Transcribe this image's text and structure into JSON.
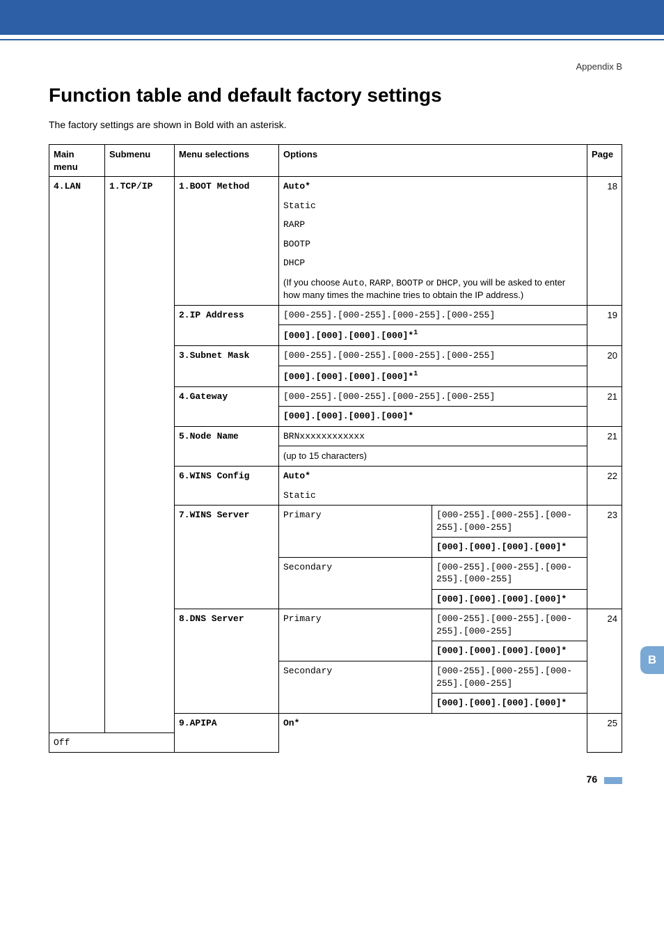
{
  "appendix_label": "Appendix B",
  "heading": "Function table and default factory settings",
  "intro": "The factory settings are shown in Bold with an asterisk.",
  "table": {
    "headers": {
      "main_menu": "Main menu",
      "submenu": "Submenu",
      "menu_selections": "Menu selections",
      "options": "Options",
      "page": "Page"
    },
    "main_menu": "4.LAN",
    "submenu": "1.TCP/IP",
    "rows": {
      "boot_method": {
        "label": "1.BOOT Method",
        "page": "18",
        "opt_auto": "Auto*",
        "opt_static": "Static",
        "opt_rarp": "RARP",
        "opt_bootp": "BOOTP",
        "opt_dhcp": "DHCP",
        "note_pre": "(If you choose ",
        "note_code1": "Auto",
        "note_sep1": ", ",
        "note_code2": "RARP",
        "note_sep2": ", ",
        "note_code3": "BOOTP",
        "note_sep3": " or ",
        "note_code4": "DHCP",
        "note_post": ", you will be asked to enter how many times the machine tries to obtain the IP address.)"
      },
      "ip_address": {
        "label": "2.IP Address",
        "page": "19",
        "range": "[000-255].[000-255].[000-255].[000-255]",
        "default": "[000].[000].[000].[000]*",
        "foot": "1"
      },
      "subnet_mask": {
        "label": "3.Subnet Mask",
        "page": "20",
        "range": "[000-255].[000-255].[000-255].[000-255]",
        "default": "[000].[000].[000].[000]*",
        "foot": "1"
      },
      "gateway": {
        "label": "4.Gateway",
        "page": "21",
        "range": "[000-255].[000-255].[000-255].[000-255]",
        "default": "[000].[000].[000].[000]*"
      },
      "node_name": {
        "label": "5.Node Name",
        "page": "21",
        "value": "BRNxxxxxxxxxxxx",
        "note": "(up to 15 characters)"
      },
      "wins_config": {
        "label": "6.WINS Config",
        "page": "22",
        "opt_auto": "Auto*",
        "opt_static": "Static"
      },
      "wins_server": {
        "label": "7.WINS Server",
        "page": "23",
        "primary_label": "Primary",
        "secondary_label": "Secondary",
        "range": "[000-255].[000-255].[000-255].[000-255]",
        "default": "[000].[000].[000].[000]*"
      },
      "dns_server": {
        "label": "8.DNS Server",
        "page": "24",
        "primary_label": "Primary",
        "secondary_label": "Secondary",
        "range": "[000-255].[000-255].[000-255].[000-255]",
        "default": "[000].[000].[000].[000]*"
      },
      "apipa": {
        "label": "9.APIPA",
        "page": "25",
        "opt_on": "On*",
        "opt_off": "Off"
      }
    }
  },
  "side_tab": "B",
  "page_number": "76"
}
